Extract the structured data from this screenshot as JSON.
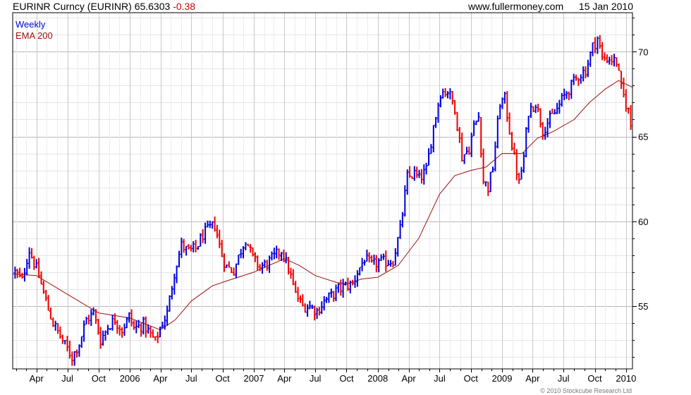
{
  "header": {
    "symbol_title": "EURINR Curncy (EURINR)",
    "last_price": "65.6303",
    "change": "-0.38",
    "website": "www.fullermoney.com",
    "date": "15 Jan 2010"
  },
  "legend": {
    "period": "Weekly",
    "ema": "EMA 200"
  },
  "copyright": "© 2010 Stockcube Research Ltd",
  "colors": {
    "up": "#0000dd",
    "down": "#ee0000",
    "ema": "#a01010",
    "grid": "#cfcfcf",
    "axis": "#000000",
    "background": "#ffffff"
  },
  "chart_data": {
    "type": "candlestick",
    "frequency": "weekly",
    "y_axis_side": "right",
    "ylim": [
      51.3,
      72.3
    ],
    "yticks": [
      55,
      60,
      65,
      70
    ],
    "xlim": [
      "2005-01-21",
      "2010-01-20"
    ],
    "xticks": [
      {
        "label": "Apr",
        "date": "2005-04-01"
      },
      {
        "label": "Jul",
        "date": "2005-07-01"
      },
      {
        "label": "Oct",
        "date": "2005-10-01"
      },
      {
        "label": "2006",
        "date": "2006-01-01"
      },
      {
        "label": "Apr",
        "date": "2006-04-01"
      },
      {
        "label": "Jul",
        "date": "2006-07-01"
      },
      {
        "label": "Oct",
        "date": "2006-10-01"
      },
      {
        "label": "2007",
        "date": "2007-01-01"
      },
      {
        "label": "Apr",
        "date": "2007-04-01"
      },
      {
        "label": "Jul",
        "date": "2007-07-01"
      },
      {
        "label": "Oct",
        "date": "2007-10-01"
      },
      {
        "label": "2008",
        "date": "2008-01-01"
      },
      {
        "label": "Apr",
        "date": "2008-04-01"
      },
      {
        "label": "Jul",
        "date": "2008-07-01"
      },
      {
        "label": "Oct",
        "date": "2008-10-01"
      },
      {
        "label": "2009",
        "date": "2009-01-01"
      },
      {
        "label": "Apr",
        "date": "2009-04-01"
      },
      {
        "label": "Jul",
        "date": "2009-07-01"
      },
      {
        "label": "Oct",
        "date": "2009-10-01"
      },
      {
        "label": "2010",
        "date": "2010-01-01"
      }
    ],
    "price_anchors": [
      [
        "2005-01-28",
        57.0
      ],
      [
        "2005-02-18",
        56.5
      ],
      [
        "2005-03-04",
        57.8
      ],
      [
        "2005-03-11",
        58.3
      ],
      [
        "2005-04-08",
        56.8
      ],
      [
        "2005-05-06",
        54.8
      ],
      [
        "2005-05-20",
        54.0
      ],
      [
        "2005-06-24",
        52.7
      ],
      [
        "2005-07-15",
        52.0
      ],
      [
        "2005-08-05",
        52.8
      ],
      [
        "2005-08-26",
        54.2
      ],
      [
        "2005-09-16",
        54.6
      ],
      [
        "2005-10-07",
        53.0
      ],
      [
        "2005-10-28",
        53.8
      ],
      [
        "2005-11-18",
        54.2
      ],
      [
        "2005-12-09",
        53.6
      ],
      [
        "2005-12-30",
        54.4
      ],
      [
        "2006-01-13",
        53.7
      ],
      [
        "2006-02-10",
        53.9
      ],
      [
        "2006-03-03",
        53.3
      ],
      [
        "2006-03-17",
        52.9
      ],
      [
        "2006-03-31",
        53.7
      ],
      [
        "2006-04-21",
        54.6
      ],
      [
        "2006-05-12",
        57.0
      ],
      [
        "2006-06-02",
        58.6
      ],
      [
        "2006-06-23",
        58.2
      ],
      [
        "2006-07-14",
        58.4
      ],
      [
        "2006-08-04",
        59.2
      ],
      [
        "2006-08-25",
        59.6
      ],
      [
        "2006-09-08",
        59.8
      ],
      [
        "2006-09-29",
        58.0
      ],
      [
        "2006-10-13",
        57.3
      ],
      [
        "2006-11-03",
        57.1
      ],
      [
        "2006-11-24",
        58.3
      ],
      [
        "2006-12-08",
        59.0
      ],
      [
        "2006-12-29",
        57.8
      ],
      [
        "2007-01-19",
        57.3
      ],
      [
        "2007-02-09",
        57.5
      ],
      [
        "2007-03-02",
        57.9
      ],
      [
        "2007-03-23",
        58.3
      ],
      [
        "2007-04-13",
        57.2
      ],
      [
        "2007-05-04",
        55.7
      ],
      [
        "2007-05-25",
        55.0
      ],
      [
        "2007-06-15",
        55.0
      ],
      [
        "2007-07-06",
        54.7
      ],
      [
        "2007-07-27",
        55.3
      ],
      [
        "2007-08-17",
        55.6
      ],
      [
        "2007-09-07",
        56.0
      ],
      [
        "2007-09-28",
        56.2
      ],
      [
        "2007-10-19",
        56.3
      ],
      [
        "2007-11-02",
        57.0
      ],
      [
        "2007-11-23",
        57.8
      ],
      [
        "2007-12-14",
        57.4
      ],
      [
        "2008-01-04",
        57.6
      ],
      [
        "2008-01-25",
        57.6
      ],
      [
        "2008-02-15",
        57.7
      ],
      [
        "2008-03-07",
        59.5
      ],
      [
        "2008-03-28",
        62.6
      ],
      [
        "2008-04-18",
        62.8
      ],
      [
        "2008-05-02",
        62.5
      ],
      [
        "2008-05-23",
        63.0
      ],
      [
        "2008-06-13",
        65.6
      ],
      [
        "2008-07-04",
        67.6
      ],
      [
        "2008-07-25",
        67.7
      ],
      [
        "2008-08-15",
        66.7
      ],
      [
        "2008-09-05",
        63.8
      ],
      [
        "2008-09-26",
        64.3
      ],
      [
        "2008-10-10",
        65.6
      ],
      [
        "2008-10-24",
        66.2
      ],
      [
        "2008-11-07",
        62.4
      ],
      [
        "2008-11-21",
        62.0
      ],
      [
        "2008-12-05",
        63.2
      ],
      [
        "2008-12-26",
        67.0
      ],
      [
        "2009-01-09",
        67.2
      ],
      [
        "2009-01-30",
        64.5
      ],
      [
        "2009-02-20",
        62.2
      ],
      [
        "2009-03-06",
        63.8
      ],
      [
        "2009-03-20",
        66.5
      ],
      [
        "2009-04-10",
        67.0
      ],
      [
        "2009-05-01",
        65.4
      ],
      [
        "2009-05-22",
        66.0
      ],
      [
        "2009-06-12",
        66.6
      ],
      [
        "2009-07-03",
        67.4
      ],
      [
        "2009-07-24",
        68.0
      ],
      [
        "2009-08-14",
        68.6
      ],
      [
        "2009-09-04",
        68.9
      ],
      [
        "2009-09-25",
        70.3
      ],
      [
        "2009-10-09",
        70.8
      ],
      [
        "2009-10-23",
        69.6
      ],
      [
        "2009-11-13",
        69.6
      ],
      [
        "2009-12-04",
        69.4
      ],
      [
        "2009-12-18",
        67.8
      ],
      [
        "2010-01-08",
        66.5
      ],
      [
        "2010-01-15",
        65.63
      ]
    ],
    "ema_200": [
      [
        "2005-01-21",
        56.9
      ],
      [
        "2005-04-01",
        56.8
      ],
      [
        "2005-07-01",
        55.7
      ],
      [
        "2005-10-01",
        54.6
      ],
      [
        "2006-01-01",
        54.3
      ],
      [
        "2006-04-01",
        53.6
      ],
      [
        "2006-05-15",
        54.2
      ],
      [
        "2006-07-01",
        55.3
      ],
      [
        "2006-09-01",
        56.2
      ],
      [
        "2006-10-15",
        56.5
      ],
      [
        "2007-01-01",
        57.0
      ],
      [
        "2007-04-01",
        57.8
      ],
      [
        "2007-05-15",
        57.4
      ],
      [
        "2007-07-01",
        56.8
      ],
      [
        "2007-09-01",
        56.4
      ],
      [
        "2007-10-01",
        56.3
      ],
      [
        "2007-11-15",
        56.6
      ],
      [
        "2008-01-01",
        56.7
      ],
      [
        "2008-03-01",
        57.4
      ],
      [
        "2008-05-01",
        59.0
      ],
      [
        "2008-07-01",
        61.6
      ],
      [
        "2008-08-15",
        62.7
      ],
      [
        "2008-10-01",
        63.0
      ],
      [
        "2008-11-15",
        63.2
      ],
      [
        "2009-01-01",
        64.0
      ],
      [
        "2009-03-01",
        64.0
      ],
      [
        "2009-04-15",
        64.9
      ],
      [
        "2009-06-01",
        65.3
      ],
      [
        "2009-08-01",
        66.0
      ],
      [
        "2009-09-15",
        67.0
      ],
      [
        "2009-11-01",
        67.8
      ],
      [
        "2009-12-10",
        68.3
      ],
      [
        "2010-01-20",
        67.9
      ]
    ]
  }
}
